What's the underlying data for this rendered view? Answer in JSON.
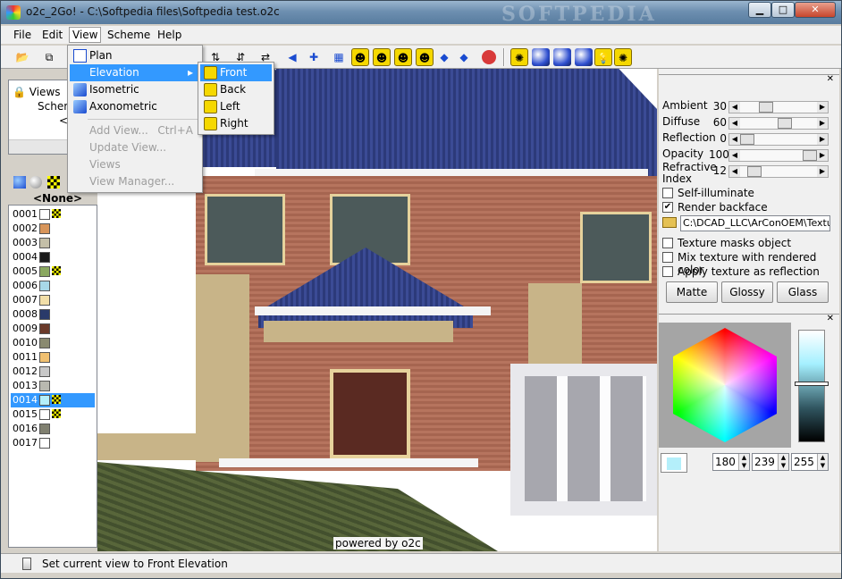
{
  "window": {
    "title": "o2c_2Go! - C:\\Softpedia files\\Softpedia test.o2c",
    "watermark": "SOFTPEDIA"
  },
  "menubar": [
    "File",
    "Edit",
    "View",
    "Scheme",
    "Help"
  ],
  "tree": {
    "items": [
      "Views",
      "Schem",
      "<N"
    ]
  },
  "materials": {
    "selected_label": "<None>",
    "items": [
      {
        "id": "0001",
        "color": "#ffffff",
        "tex": true
      },
      {
        "id": "0002",
        "color": "#d8955a",
        "tex": false
      },
      {
        "id": "0003",
        "color": "#c4bfa8",
        "tex": false
      },
      {
        "id": "0004",
        "color": "#1a1a1a",
        "tex": false
      },
      {
        "id": "0005",
        "color": "#8aa860",
        "tex": true
      },
      {
        "id": "0006",
        "color": "#a8d8e8",
        "tex": false
      },
      {
        "id": "0007",
        "color": "#f2dfa8",
        "tex": false
      },
      {
        "id": "0008",
        "color": "#2a3a6a",
        "tex": false
      },
      {
        "id": "0009",
        "color": "#6a3a2a",
        "tex": false
      },
      {
        "id": "0010",
        "color": "#8a8a70",
        "tex": false
      },
      {
        "id": "0011",
        "color": "#f0c070",
        "tex": false
      },
      {
        "id": "0012",
        "color": "#c8c8c8",
        "tex": false
      },
      {
        "id": "0013",
        "color": "#b8b8b0",
        "tex": false
      },
      {
        "id": "0014",
        "color": "#b4effa",
        "tex": true
      },
      {
        "id": "0015",
        "color": "#ffffff",
        "tex": true
      },
      {
        "id": "0016",
        "color": "#808070",
        "tex": false
      },
      {
        "id": "0017",
        "color": "#ffffff",
        "tex": false
      }
    ],
    "selected_index": 13
  },
  "view_menu": {
    "items": [
      {
        "label": "Plan",
        "enabled": true
      },
      {
        "label": "Elevation",
        "enabled": true,
        "submenu": true
      },
      {
        "label": "Isometric",
        "enabled": true
      },
      {
        "label": "Axonometric",
        "enabled": true
      },
      {
        "label": "Add View...",
        "accel": "Ctrl+A",
        "enabled": false
      },
      {
        "label": "Update View...",
        "enabled": false
      },
      {
        "label": "Views",
        "enabled": false
      },
      {
        "label": "View Manager...",
        "enabled": false
      }
    ]
  },
  "elevation_submenu": [
    "Front",
    "Back",
    "Left",
    "Right"
  ],
  "viewport": {
    "caption": "powered by o2c"
  },
  "properties": {
    "sliders": [
      {
        "label": "Ambient",
        "value": "30",
        "pos": 0.3
      },
      {
        "label": "Diffuse",
        "value": "60",
        "pos": 0.6
      },
      {
        "label": "Reflection",
        "value": "0",
        "pos": 0
      },
      {
        "label": "Opacity",
        "value": "100",
        "pos": 1
      },
      {
        "label": "Refractive Index",
        "value": "12",
        "pos": 0.12
      }
    ],
    "checkboxes_top": [
      {
        "label": "Self-illuminate",
        "checked": false
      },
      {
        "label": "Render backface",
        "checked": true
      }
    ],
    "texture_path": "C:\\DCAD_LLC\\ArConOEM\\Textur",
    "checkboxes_bottom": [
      {
        "label": "Texture masks object",
        "checked": false
      },
      {
        "label": "Mix texture with rendered color",
        "checked": false
      },
      {
        "label": "Apply texture as reflection map",
        "checked": false
      }
    ],
    "buttons": [
      "Matte",
      "Glossy",
      "Glass"
    ]
  },
  "color": {
    "r": "180",
    "g": "239",
    "b": "255",
    "swatch": "#b4effa"
  },
  "status": {
    "text": "Set current view to Front Elevation"
  }
}
